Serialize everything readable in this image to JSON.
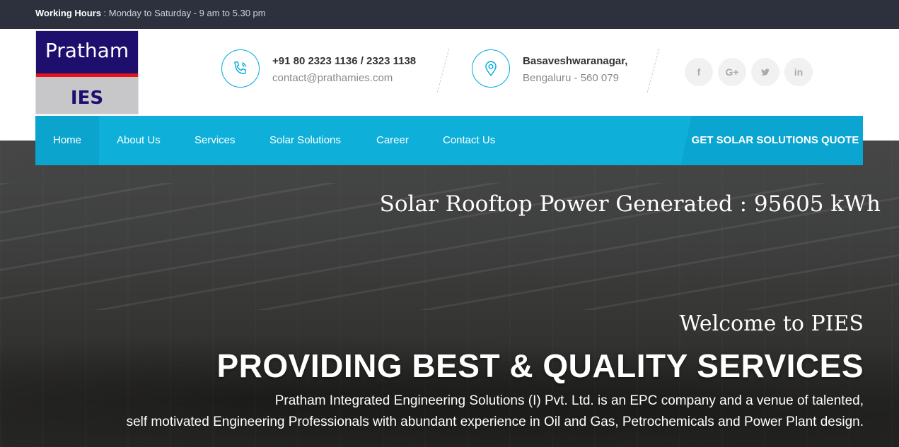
{
  "topbar": {
    "label": "Working Hours",
    "text": " : Monday to Saturday - 9 am to 5.30 pm"
  },
  "logo": {
    "line1": "Pratham",
    "line2": "IES"
  },
  "contact": {
    "phone": "+91 80 2323 1136 / 2323 1138",
    "email": "contact@prathamies.com",
    "phone_icon": "phone-icon"
  },
  "address": {
    "line1": "Basaveshwaranagar,",
    "line2": "Bengaluru - 560 079",
    "icon": "location-pin-icon"
  },
  "social": [
    {
      "name": "facebook",
      "glyph": "f"
    },
    {
      "name": "google-plus",
      "glyph": "G+"
    },
    {
      "name": "twitter",
      "glyph": "t"
    },
    {
      "name": "linkedin",
      "glyph": "in"
    }
  ],
  "nav": {
    "items": [
      {
        "label": "Home"
      },
      {
        "label": "About Us"
      },
      {
        "label": "Services"
      },
      {
        "label": "Solar Solutions"
      },
      {
        "label": "Career"
      },
      {
        "label": "Contact Us"
      }
    ],
    "cta": "GET SOLAR SOLUTIONS QUOTE"
  },
  "hero": {
    "power": "Solar Rooftop Power Generated : 95605 kWh",
    "welcome": "Welcome to PIES",
    "headline": "PROVIDING BEST & QUALITY SERVICES",
    "desc_line1": "Pratham Integrated Engineering Solutions (I) Pvt. Ltd. is an EPC company and a venue of talented,",
    "desc_line2": "self motivated Engineering Professionals with abundant experience in Oil and Gas, Petrochemicals and Power Plant design."
  },
  "colors": {
    "accent": "#0eb0da",
    "topbar": "#2c313d",
    "logo_blue": "#1e0f6e",
    "logo_red": "#e3141c"
  }
}
